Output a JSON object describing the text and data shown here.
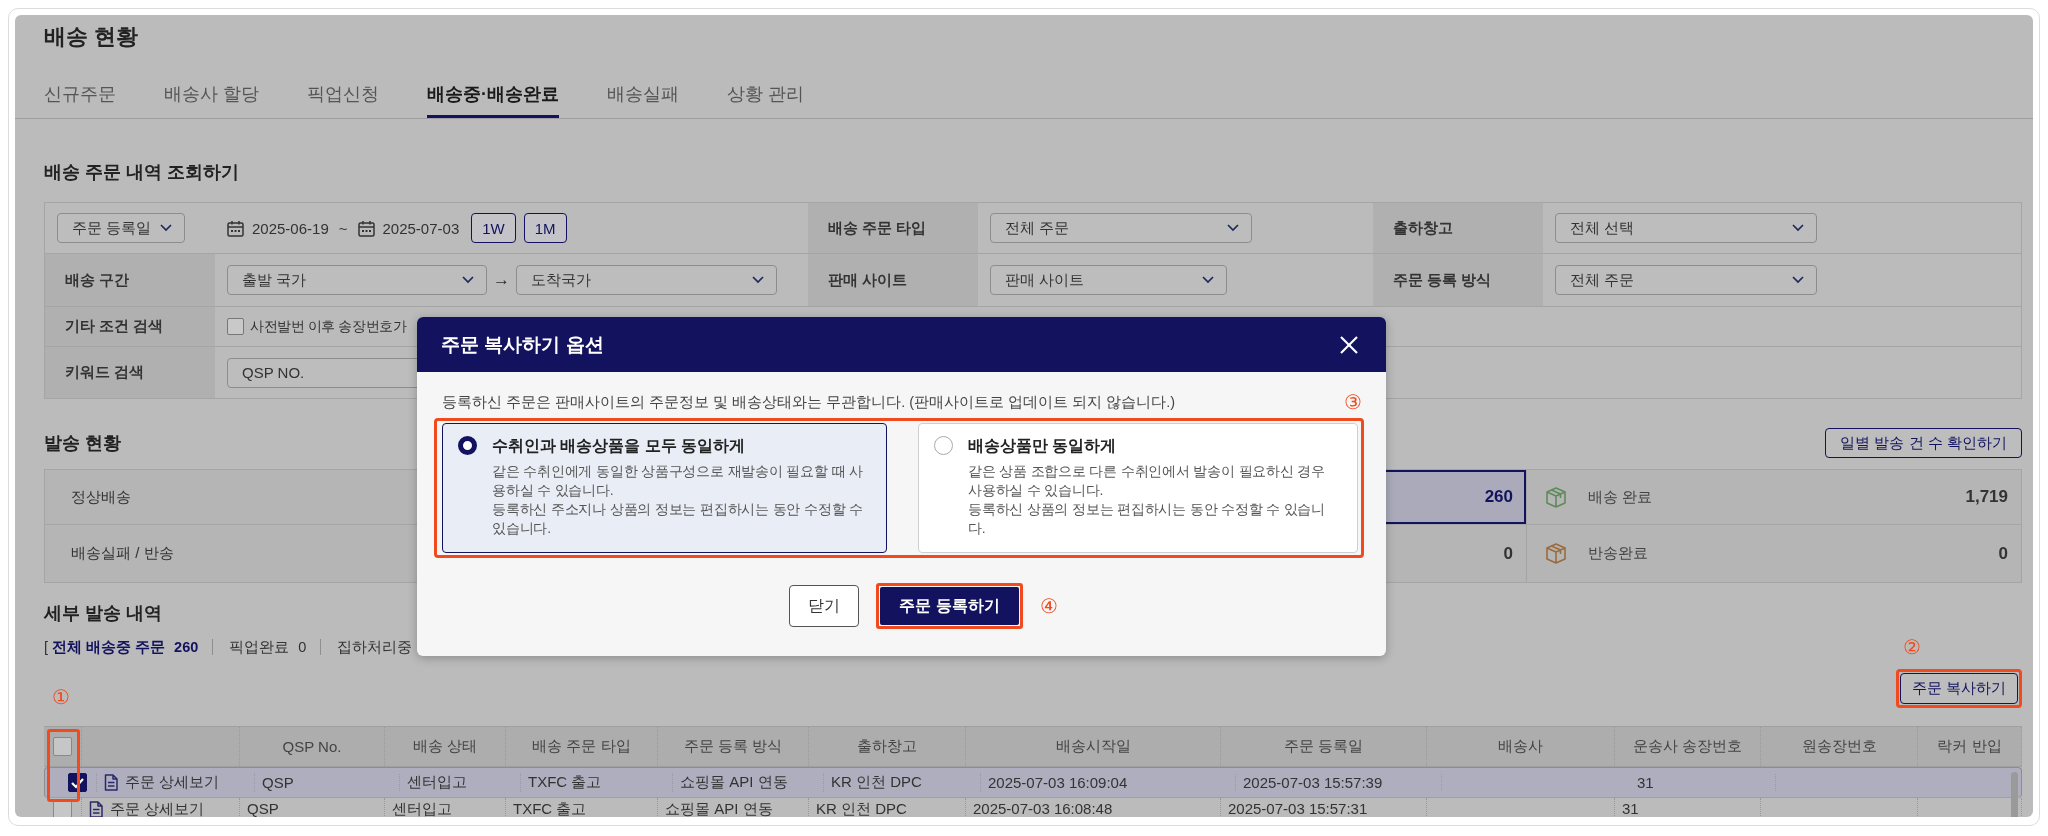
{
  "page": {
    "title": "배송 현황"
  },
  "tabs": [
    {
      "label": "신규주문",
      "selected": false
    },
    {
      "label": "배송사 할당",
      "selected": false
    },
    {
      "label": "픽업신청",
      "selected": false
    },
    {
      "label": "배송중·배송완료",
      "selected": true
    },
    {
      "label": "배송실패",
      "selected": false
    },
    {
      "label": "상황 관리",
      "selected": false
    }
  ],
  "search": {
    "title": "배송 주문 내역 조회하기",
    "date_filter": {
      "type": "주문 등록일",
      "from": "2025-06-19",
      "separator": "~",
      "to": "2025-07-03",
      "presets": [
        "1W",
        "1M"
      ]
    },
    "order_type": {
      "label": "배송 주문 타입",
      "value": "전체 주문"
    },
    "warehouse": {
      "label": "출하창고",
      "value": "전체 선택"
    },
    "route": {
      "label": "배송 구간",
      "from": "출발 국가",
      "arrow": "→",
      "to": "도착국가"
    },
    "sales_site": {
      "label": "판매 사이트",
      "value": "판매 사이트"
    },
    "registration_method": {
      "label": "주문 등록 방식",
      "value": "전체 주문"
    },
    "other": {
      "label": "기타 조건 검색",
      "checkbox": {
        "label": "사전발번 이후 송장번호가",
        "checked": false
      }
    },
    "keyword": {
      "label": "키워드 검색",
      "type": "QSP NO."
    }
  },
  "shipment_status": {
    "title": "발송 현황",
    "daily_button": "일별 발송 건 수 확인하기",
    "rows": [
      {
        "label": "정상배송",
        "value": "260",
        "selected": true,
        "done_label": "배송 완료",
        "done_value": "1,719",
        "color": "#5f8a5c"
      },
      {
        "label": "배송실패 / 반송",
        "value": "0",
        "selected": false,
        "done_label": "반송완료",
        "done_value": "0",
        "color": "#9a6c3c"
      }
    ]
  },
  "details": {
    "title": "세부 발송 내역",
    "bracket": "[",
    "summary": [
      {
        "label": "전체 배송중 주문",
        "count": "260",
        "selected": true
      },
      {
        "label": "픽업완료",
        "count": "0",
        "selected": false
      },
      {
        "label": "집하처리중",
        "selected": false
      }
    ],
    "copy_marker": "②",
    "copy_button": "주문 복사하기",
    "table_marker": "①"
  },
  "table": {
    "header_checked": false,
    "columns": [
      "QSP No.",
      "배송 상태",
      "배송 주문 타입",
      "주문 등록 방식",
      "출하창고",
      "배송시작일",
      "주문 등록일",
      "배송사",
      "운송사 송장번호",
      "원송장번호",
      "락커 반입"
    ],
    "rows": [
      {
        "checked": true,
        "selected": true,
        "link": "주문 상세보기",
        "cells": [
          "QSP",
          "센터입고",
          "TXFC 출고",
          "쇼핑몰 API 연동",
          "KR 인천 DPC",
          "2025-07-03 16:09:04",
          "2025-07-03 15:57:39",
          null,
          "31",
          null,
          null
        ]
      },
      {
        "checked": false,
        "selected": false,
        "link": "주문 상세보기",
        "cells": [
          "QSP",
          "센터입고",
          "TXFC 출고",
          "쇼핑몰 API 연동",
          "KR 인천 DPC",
          "2025-07-03 16:08:48",
          "2025-07-03 15:57:31",
          null,
          "31",
          null,
          null
        ]
      }
    ]
  },
  "dialog": {
    "title": "주문 복사하기 옵션",
    "notice": "등록하신 주문은 판매사이트의 주문정보 및 배송상태와는 무관합니다. (판매사이트로 업데이트 되지 않습니다.)",
    "options_marker": "③",
    "options": [
      {
        "title": "수취인과 배송상품을 모두 동일하게",
        "selected": true,
        "description": [
          "같은 수취인에게 동일한 상품구성으로 재발송이 필요할 때 사용하실 수 있습니다.",
          "등록하신 주소지나 상품의 정보는 편집하시는 동안 수정할 수 있습니다."
        ]
      },
      {
        "title": "배송상품만 동일하게",
        "selected": false,
        "description": [
          "같은 상품 조합으로 다른 수취인에서 발송이 필요하신 경우 사용하실 수 있습니다.",
          "등록하신 상품의 정보는 편집하시는 동안 수정할 수 있습니다."
        ]
      }
    ],
    "close_button": "닫기",
    "submit_button": "주문 등록하기",
    "submit_marker": "④"
  }
}
